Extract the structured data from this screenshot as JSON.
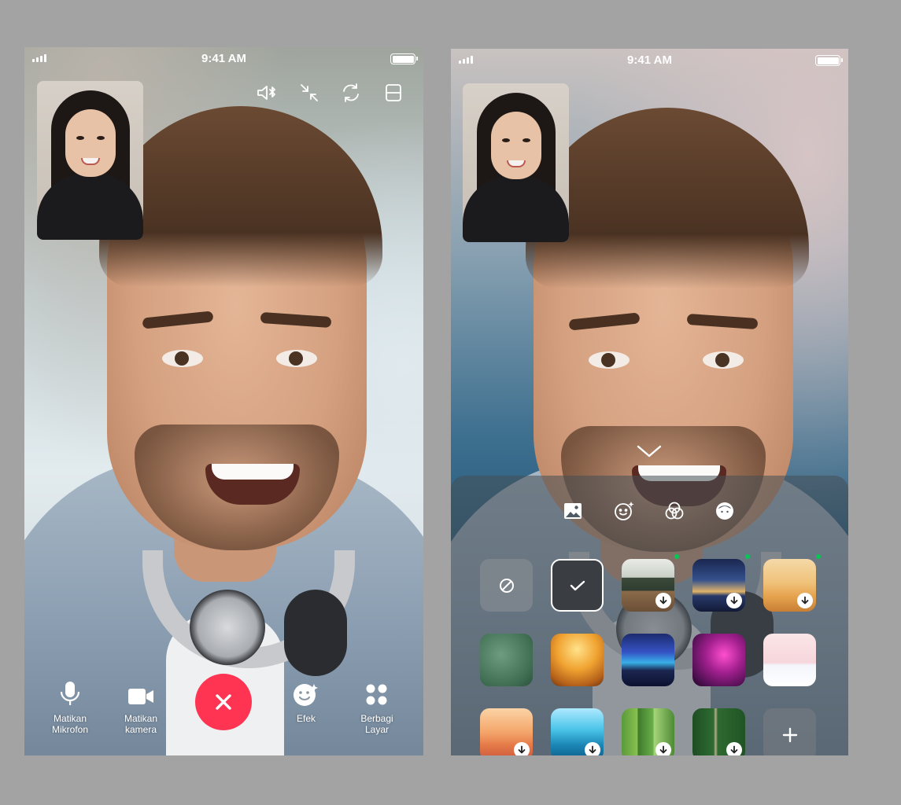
{
  "status_bar": {
    "time": "9:41 AM"
  },
  "colors": {
    "end_call": "#ff3352",
    "new_indicator": "#06c755",
    "canvas_background": "#a3a3a3"
  },
  "left_screen": {
    "top_icons": [
      {
        "name": "bluetooth-speaker-icon"
      },
      {
        "name": "minimize-icon"
      },
      {
        "name": "switch-camera-icon"
      },
      {
        "name": "layout-icon"
      }
    ],
    "controls": {
      "mute_mic": {
        "line1": "Matikan",
        "line2": "Mikrofon",
        "icon": "microphone-icon"
      },
      "camera_off": {
        "line1": "Matikan",
        "line2": "kamera",
        "icon": "video-camera-icon"
      },
      "end_call": {
        "icon": "close-icon"
      },
      "effects": {
        "label": "Efek",
        "icon": "effects-icon"
      },
      "share_screen": {
        "line1": "Berbagi",
        "line2": "Layar",
        "icon": "share-screen-icon"
      }
    }
  },
  "right_screen": {
    "effect_tabs": [
      {
        "name": "background-tab",
        "icon": "image-icon",
        "active": true
      },
      {
        "name": "effects-tab",
        "icon": "smiley-sparkle-icon",
        "active": false
      },
      {
        "name": "filters-tab",
        "icon": "filter-circles-icon",
        "active": false
      },
      {
        "name": "avatar-tab",
        "icon": "avatar-icon",
        "active": false
      }
    ],
    "backgrounds": [
      {
        "type": "none",
        "icon": "no-background-icon"
      },
      {
        "type": "blur",
        "selected": true,
        "icon": "check-icon"
      },
      {
        "type": "image",
        "scene": "classroom",
        "download": true,
        "new": true
      },
      {
        "type": "image",
        "scene": "city-night",
        "download": true,
        "new": true
      },
      {
        "type": "image",
        "scene": "cozy-room",
        "download": true,
        "new": true
      },
      {
        "type": "image",
        "scene": "chalkboard"
      },
      {
        "type": "image",
        "scene": "autumn-forest"
      },
      {
        "type": "image",
        "scene": "neon-street"
      },
      {
        "type": "image",
        "scene": "neon-glasses"
      },
      {
        "type": "image",
        "scene": "snowy-landscape"
      },
      {
        "type": "image",
        "scene": "character-party",
        "download": true
      },
      {
        "type": "image",
        "scene": "ocean",
        "download": true
      },
      {
        "type": "image",
        "scene": "aerial-fields",
        "download": true
      },
      {
        "type": "image",
        "scene": "aerial-forest",
        "download": true
      },
      {
        "type": "add",
        "icon": "plus-icon"
      }
    ]
  }
}
